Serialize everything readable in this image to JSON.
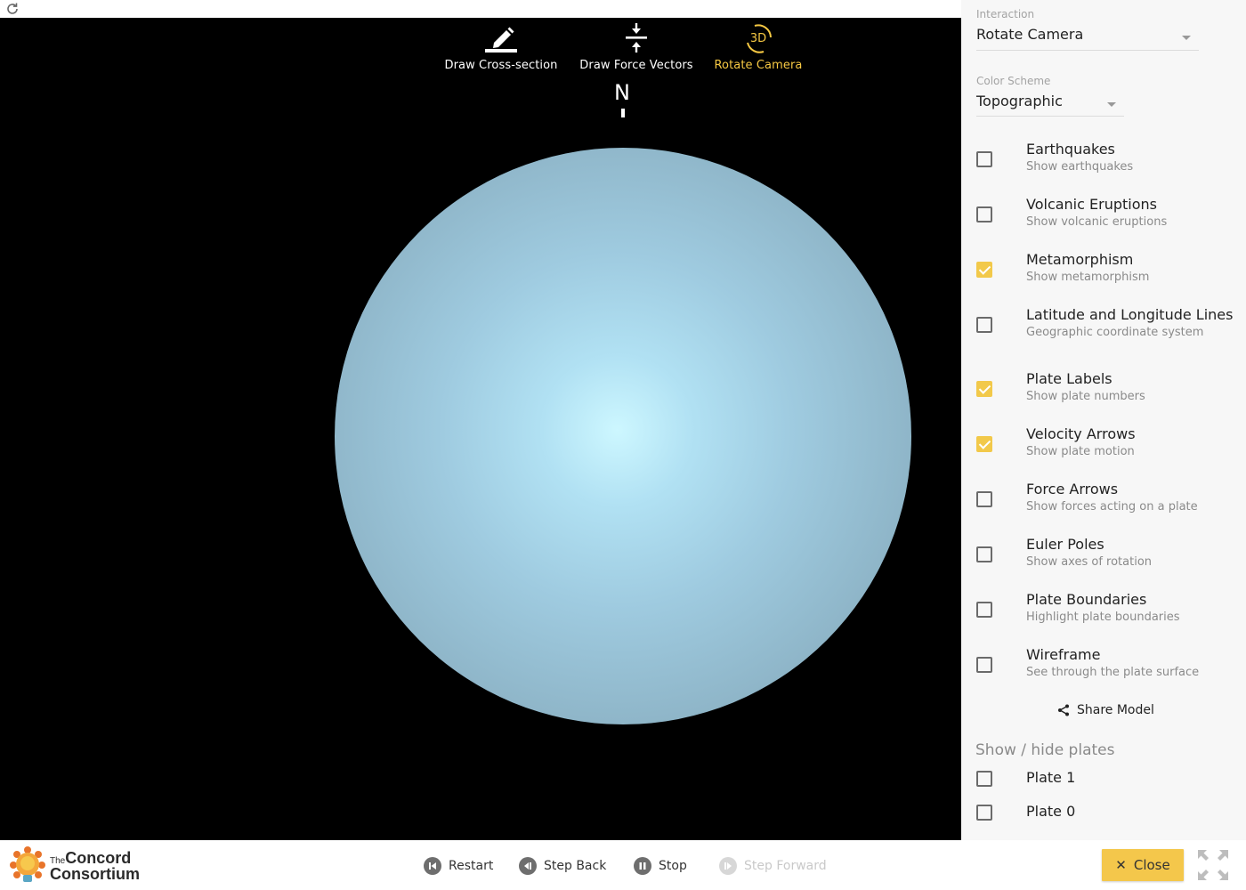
{
  "toolbar": {
    "tools": [
      {
        "label": "Draw Cross-section",
        "icon": "pencil-icon",
        "active": false
      },
      {
        "label": "Draw Force Vectors",
        "icon": "force-vectors-icon",
        "active": false
      },
      {
        "label": "Rotate Camera",
        "icon": "rotate-3d-icon",
        "active": true,
        "icon_text": "3D"
      }
    ],
    "compass": "N"
  },
  "sidebar": {
    "interaction": {
      "label": "Interaction",
      "value": "Rotate Camera"
    },
    "color_scheme": {
      "label": "Color Scheme",
      "value": "Topographic"
    },
    "options": [
      {
        "title": "Earthquakes",
        "subtitle": "Show earthquakes",
        "checked": false
      },
      {
        "title": "Volcanic Eruptions",
        "subtitle": "Show volcanic eruptions",
        "checked": false
      },
      {
        "title": "Metamorphism",
        "subtitle": "Show metamorphism",
        "checked": true
      },
      {
        "title": "Latitude and Longitude Lines",
        "subtitle": "Geographic coordinate system",
        "checked": false
      },
      {
        "title": "Plate Labels",
        "subtitle": "Show plate numbers",
        "checked": true
      },
      {
        "title": "Velocity Arrows",
        "subtitle": "Show plate motion",
        "checked": true
      },
      {
        "title": "Force Arrows",
        "subtitle": "Show forces acting on a plate",
        "checked": false
      },
      {
        "title": "Euler Poles",
        "subtitle": "Show axes of rotation",
        "checked": false
      },
      {
        "title": "Plate Boundaries",
        "subtitle": "Highlight plate boundaries",
        "checked": false
      },
      {
        "title": "Wireframe",
        "subtitle": "See through the plate surface",
        "checked": false
      }
    ],
    "share_label": "Share Model",
    "plates_title": "Show / hide plates",
    "plates": [
      {
        "label": "Plate 1",
        "checked": false
      },
      {
        "label": "Plate 0",
        "checked": false
      }
    ]
  },
  "bottombar": {
    "logo": {
      "the": "The",
      "line1": "Concord",
      "line2": "Consortium"
    },
    "controls": [
      {
        "label": "Restart",
        "icon": "restart-icon",
        "disabled": false
      },
      {
        "label": "Step Back",
        "icon": "step-back-icon",
        "disabled": false
      },
      {
        "label": "Stop",
        "icon": "pause-icon",
        "disabled": false
      },
      {
        "label": "Step Forward",
        "icon": "step-forward-icon",
        "disabled": true
      }
    ],
    "close_label": "Close"
  },
  "colors": {
    "accent": "#f2c94a",
    "canvas_bg": "#000000",
    "sidebar_bg": "#f7f7f7"
  }
}
